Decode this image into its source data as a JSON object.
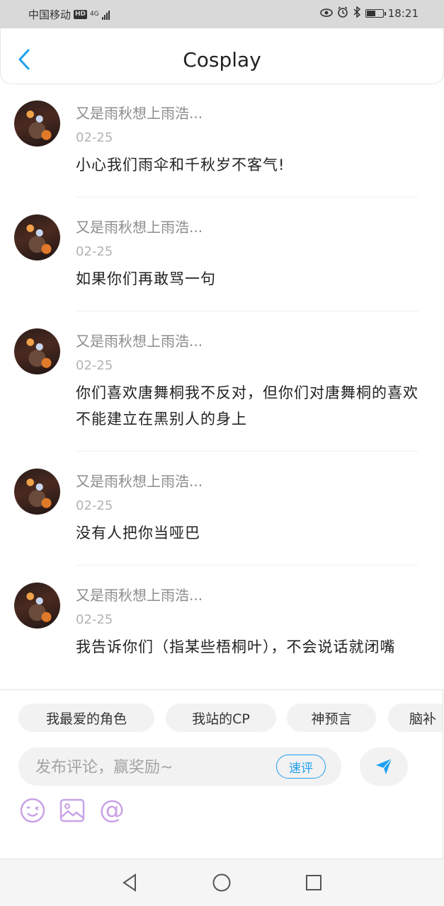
{
  "status_bar": {
    "carrier": "中国移动",
    "hd": "HD",
    "network": "4G",
    "time": "18:21",
    "battery_level": 0.6
  },
  "header": {
    "title": "Cosplay",
    "back_icon": "chevron-left-icon",
    "accent": "#1ea0f0"
  },
  "comments": [
    {
      "user": "又是雨秋想上雨浩...",
      "date": "02-25",
      "text": "小心我们雨伞和千秋岁不客气!"
    },
    {
      "user": "又是雨秋想上雨浩...",
      "date": "02-25",
      "text": "如果你们再敢骂一句"
    },
    {
      "user": "又是雨秋想上雨浩...",
      "date": "02-25",
      "text": "你们喜欢唐舞桐我不反对，但你们对唐舞桐的喜欢不能建立在黑别人的身上"
    },
    {
      "user": "又是雨秋想上雨浩...",
      "date": "02-25",
      "text": "没有人把你当哑巴"
    },
    {
      "user": "又是雨秋想上雨浩...",
      "date": "02-25",
      "text": "我告诉你们（指某些梧桐叶），不会说话就闭嘴"
    }
  ],
  "tags": [
    "我最爱的角色",
    "我站的CP",
    "神预言",
    "脑补"
  ],
  "composer": {
    "placeholder": "发布评论，赢奖励~",
    "quick_review": "速评",
    "tool_color": "#c9a3e6"
  }
}
